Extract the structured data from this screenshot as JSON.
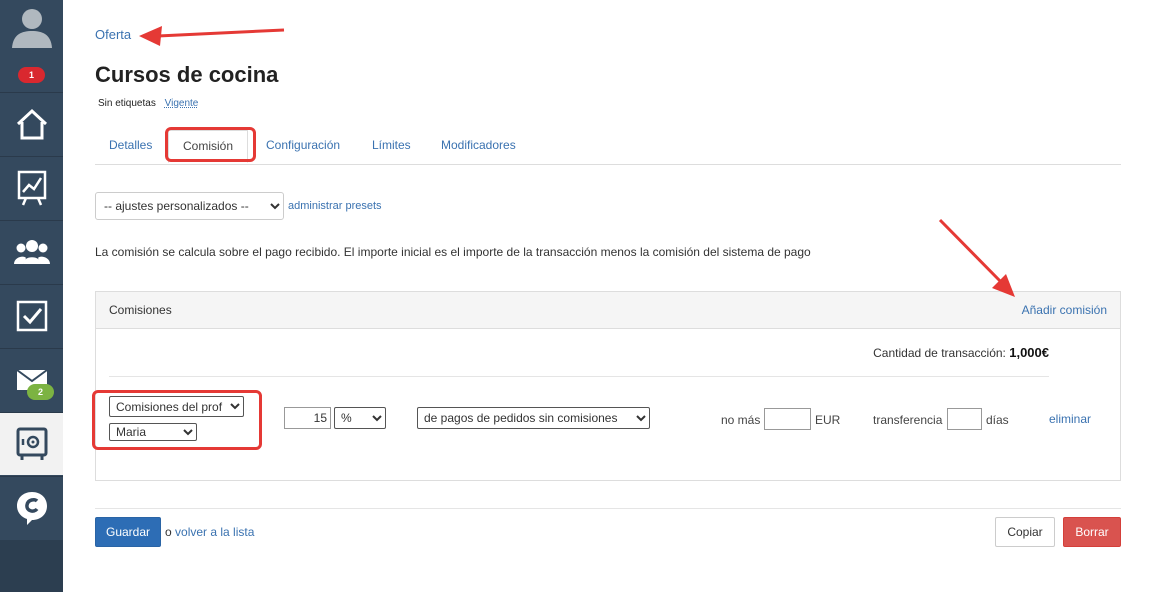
{
  "sidebar": {
    "notifications_badge": "1",
    "mail_badge": "2",
    "items": [
      {
        "icon": "user-avatar-icon"
      },
      {
        "icon": "home-icon"
      },
      {
        "icon": "chart-icon"
      },
      {
        "icon": "users-icon"
      },
      {
        "icon": "checkbox-icon"
      },
      {
        "icon": "mail-icon"
      },
      {
        "icon": "safe-icon"
      },
      {
        "icon": "chat-logo-icon"
      }
    ]
  },
  "breadcrumb": "Oferta",
  "page_title": "Cursos de cocina",
  "tags": {
    "label": "Sin etiquetas",
    "status": "Vigente"
  },
  "tabs": [
    {
      "label": "Detalles"
    },
    {
      "label": "Comisión",
      "active": true
    },
    {
      "label": "Configuración"
    },
    {
      "label": "Límites"
    },
    {
      "label": "Modificadores"
    }
  ],
  "preset": {
    "selected": "-- ajustes personalizados --",
    "manage_link": "administrar presets"
  },
  "description": "La comisión se calcula sobre el pago recibido. El importe inicial es el importe de la transacción menos la comisión del sistema de pago",
  "commissions": {
    "title": "Comisiones",
    "add_link": "Añadir comisión",
    "amount_label": "Cantidad de transacción:",
    "amount_value": "1,000€",
    "row": {
      "type_select": "Comisiones del prof",
      "person_select": "Maria",
      "value": "15",
      "unit_select": "%",
      "base_select": "de pagos de pedidos sin comisiones",
      "max_label": "no más",
      "max_value": "",
      "currency": "EUR",
      "transfer_label": "transferencia",
      "transfer_value": "",
      "days_label": "días",
      "delete_link": "eliminar"
    }
  },
  "footer": {
    "save": "Guardar",
    "or": "o",
    "back_link": "volver a la lista",
    "copy": "Copiar",
    "delete": "Borrar"
  },
  "colors": {
    "sidebar": "#34495e",
    "link": "#3a72b0",
    "primary": "#2d6db5",
    "danger": "#d9534f",
    "annotation": "#e53935"
  }
}
